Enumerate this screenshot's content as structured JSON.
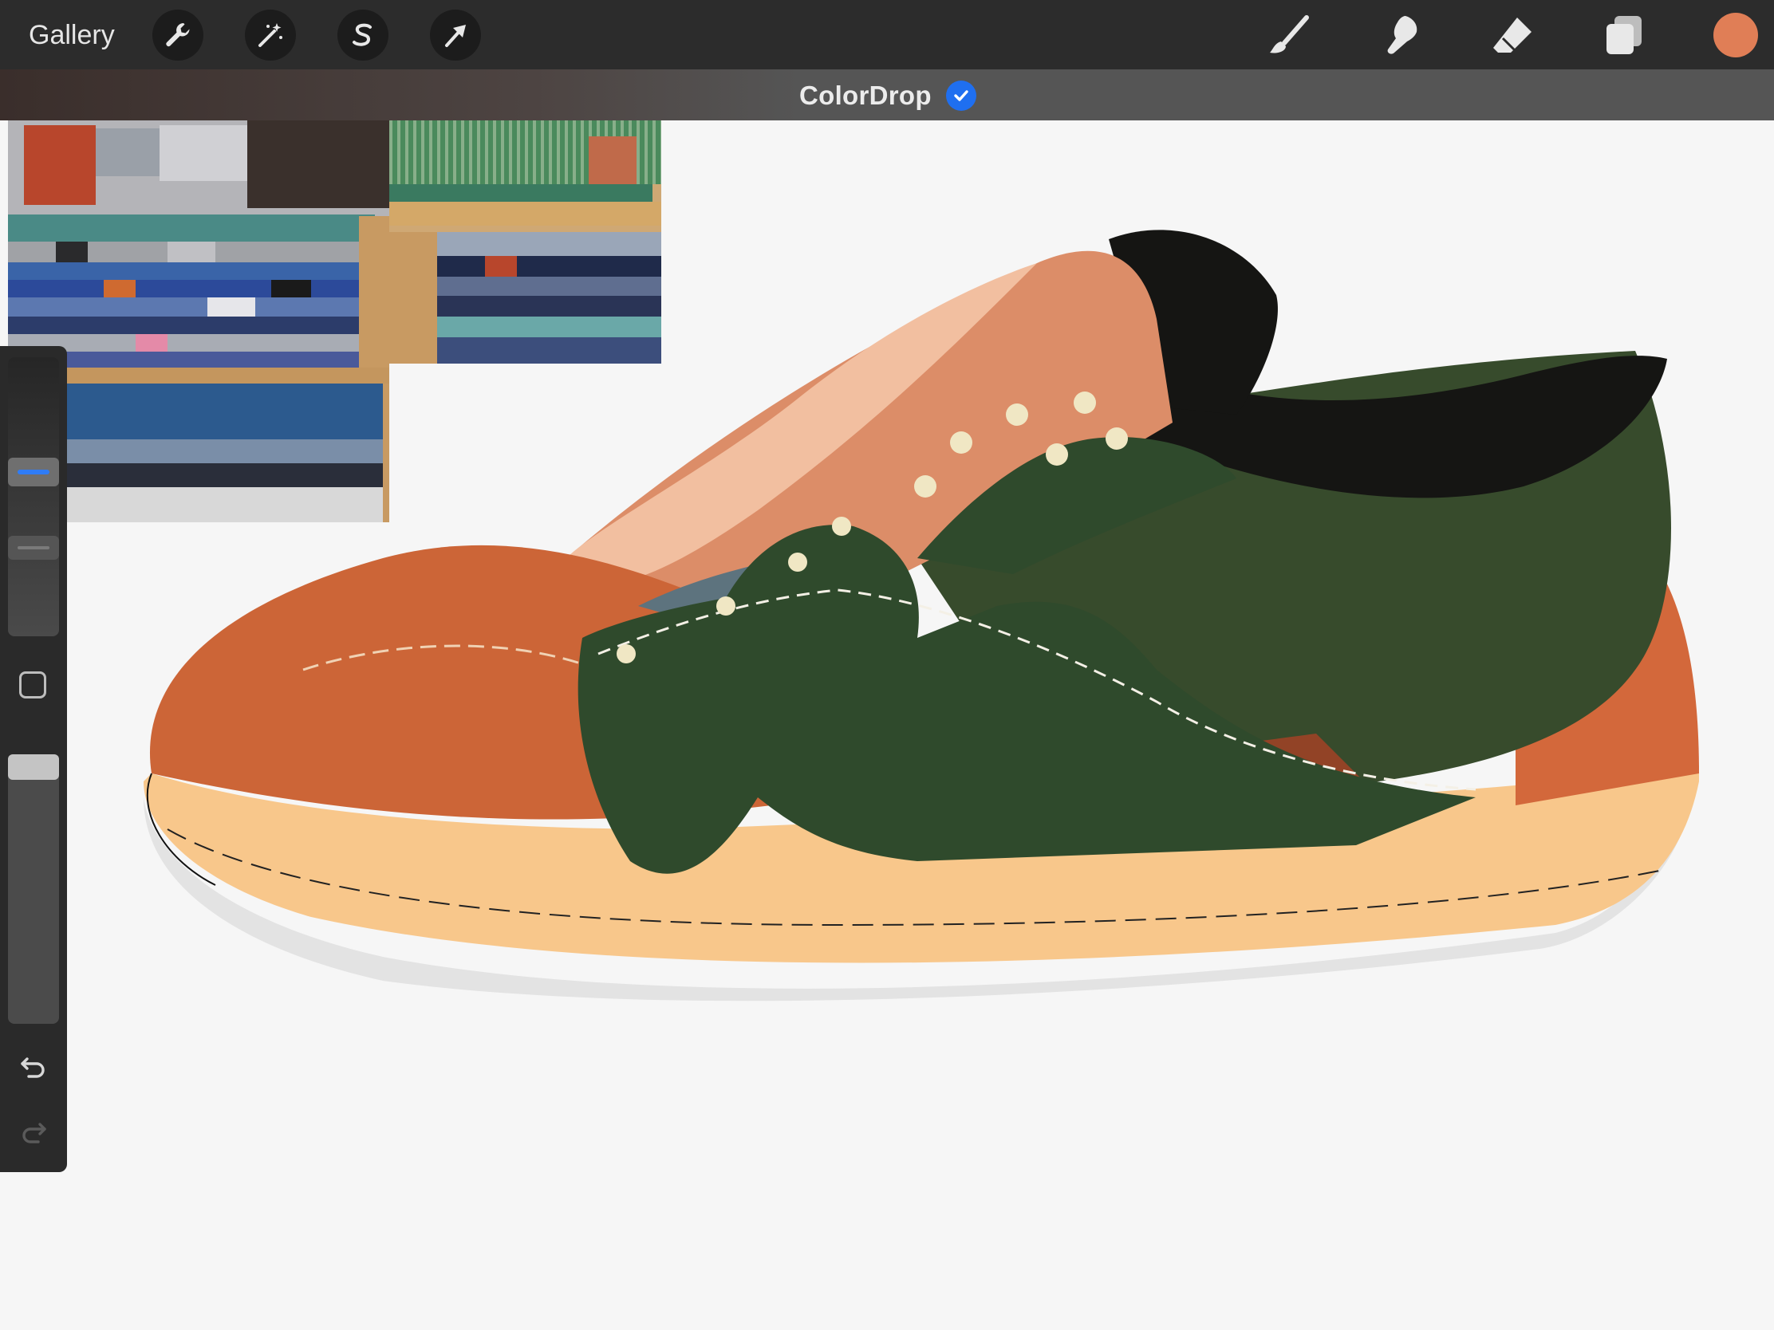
{
  "topbar": {
    "gallery_label": "Gallery",
    "left_tools": [
      {
        "name": "actions",
        "icon": "wrench-icon"
      },
      {
        "name": "adjustments",
        "icon": "magic-wand-icon"
      },
      {
        "name": "selection",
        "icon": "selection-s-icon"
      },
      {
        "name": "transform",
        "icon": "arrow-cursor-icon"
      }
    ],
    "right_tools": [
      {
        "name": "brush",
        "icon": "brush-icon"
      },
      {
        "name": "smudge",
        "icon": "smudge-icon"
      },
      {
        "name": "eraser",
        "icon": "eraser-icon"
      },
      {
        "name": "layers",
        "icon": "layers-icon"
      }
    ],
    "current_color": "#e07e56"
  },
  "notice": {
    "text": "ColorDrop",
    "check_icon": "check-circle-icon",
    "check_color": "#1f6ff0"
  },
  "sidebar": {
    "brush_size_level": 0.6,
    "opacity_level": 1.0,
    "accent_color": "#2f7cf6",
    "undo_icon": "undo-icon",
    "redo_icon": "redo-icon",
    "modify_icon": "square-icon"
  },
  "canvas": {
    "background": "#f6f6f6",
    "palette": {
      "toe": "#cc6537",
      "tongue_light": "#f2bfa0",
      "tongue": "#dc8d68",
      "collar": "#151513",
      "panel_green": "#374b2c",
      "overlay_green": "#2f4a2c",
      "blue_panel": "#5d737e",
      "heel": "#d3683b",
      "midsole": "#f8c78b",
      "outsole": "#e3e3e3",
      "stripe_dark": "#924326",
      "eyelet": "#f0e7c4"
    }
  }
}
